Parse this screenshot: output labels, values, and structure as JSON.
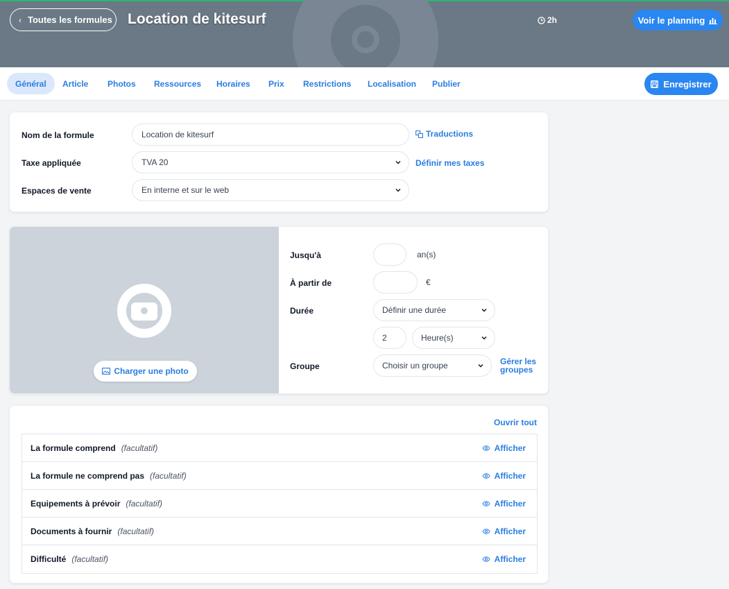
{
  "header": {
    "back_label": "Toutes les formules",
    "title": "Location de kitesurf",
    "duration": "2h",
    "planning_label": "Voir le planning"
  },
  "tabs": [
    {
      "label": "Général",
      "active": true
    },
    {
      "label": "Article"
    },
    {
      "label": "Photos"
    },
    {
      "label": "Ressources"
    },
    {
      "label": "Horaires"
    },
    {
      "label": "Prix"
    },
    {
      "label": "Restrictions"
    },
    {
      "label": "Localisation"
    },
    {
      "label": "Publier"
    }
  ],
  "save_label": "Enregistrer",
  "general": {
    "name_label": "Nom de la formule",
    "name_value": "Location de kitesurf",
    "translations_label": "Traductions",
    "tax_label": "Taxe appliquée",
    "tax_value": "TVA 20",
    "define_taxes_label": "Définir mes taxes",
    "sales_label": "Espaces de vente",
    "sales_value": "En interne et sur le web"
  },
  "details": {
    "upload_label": "Charger une photo",
    "until_label": "Jusqu'à",
    "until_value": "",
    "until_unit": "an(s)",
    "from_label": "À partir de",
    "from_value": "",
    "from_unit": "€",
    "duration_label": "Durée",
    "duration_select": "Définir une durée",
    "duration_amount": "2",
    "duration_unit": "Heure(s)",
    "group_label": "Groupe",
    "group_select": "Choisir un groupe",
    "manage_groups_line1": "Gérer les",
    "manage_groups_line2": "groupes"
  },
  "sections": {
    "open_all_label": "Ouvrir tout",
    "show_label": "Afficher",
    "optional_label": "(facultatif)",
    "items": [
      "La formule comprend",
      "La formule ne comprend pas",
      "Equipements à prévoir",
      "Documents à fournir",
      "Difficulté"
    ]
  },
  "colors": {
    "accent": "#2a86f0",
    "link": "#2a7de1",
    "banner": "#6b7885",
    "tab_active_bg": "#dbe8fb",
    "photo_bg": "#ccd3da"
  }
}
